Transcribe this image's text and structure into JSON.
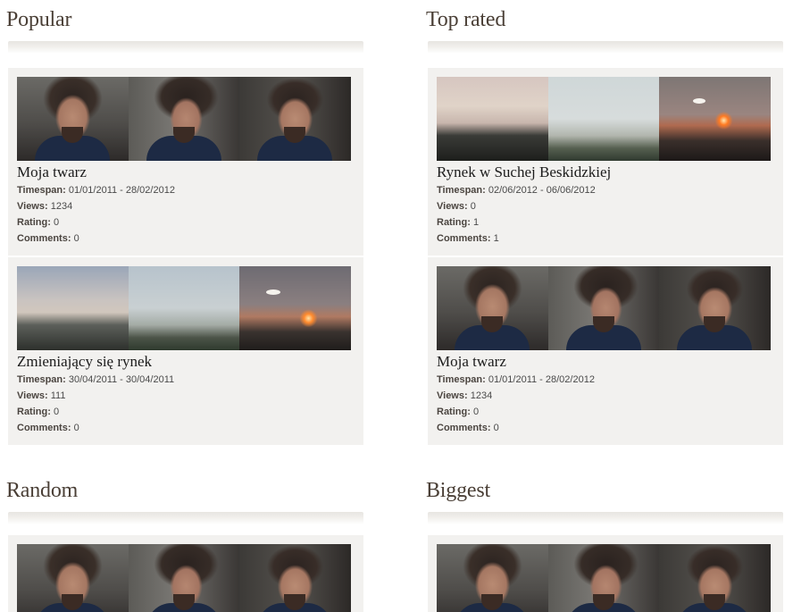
{
  "sections": {
    "popular": {
      "title": "Popular",
      "items": [
        {
          "title": "Moja twarz",
          "thumbs": [
            "face",
            "face",
            "face"
          ],
          "timespan_label": "Timespan:",
          "timespan": "01/01/2011 - 28/02/2012",
          "views_label": "Views:",
          "views": "1234",
          "rating_label": "Rating:",
          "rating": "0",
          "comments_label": "Comments:",
          "comments": "0"
        },
        {
          "title": "Zmieniający się rynek",
          "thumbs": [
            "sky",
            "sky",
            "sky-sunset"
          ],
          "timespan_label": "Timespan:",
          "timespan": "30/04/2011 - 30/04/2011",
          "views_label": "Views:",
          "views": "111",
          "rating_label": "Rating:",
          "rating": "0",
          "comments_label": "Comments:",
          "comments": "0"
        }
      ]
    },
    "top_rated": {
      "title": "Top rated",
      "items": [
        {
          "title": "Rynek w Suchej Beskidzkiej",
          "thumbs": [
            "sky",
            "sky",
            "sky-sunset"
          ],
          "timespan_label": "Timespan:",
          "timespan": "02/06/2012 - 06/06/2012",
          "views_label": "Views:",
          "views": "0",
          "rating_label": "Rating:",
          "rating": "1",
          "comments_label": "Comments:",
          "comments": "1"
        },
        {
          "title": "Moja twarz",
          "thumbs": [
            "face",
            "face",
            "face"
          ],
          "timespan_label": "Timespan:",
          "timespan": "01/01/2011 - 28/02/2012",
          "views_label": "Views:",
          "views": "1234",
          "rating_label": "Rating:",
          "rating": "0",
          "comments_label": "Comments:",
          "comments": "0"
        }
      ]
    },
    "random": {
      "title": "Random"
    },
    "biggest": {
      "title": "Biggest"
    }
  }
}
